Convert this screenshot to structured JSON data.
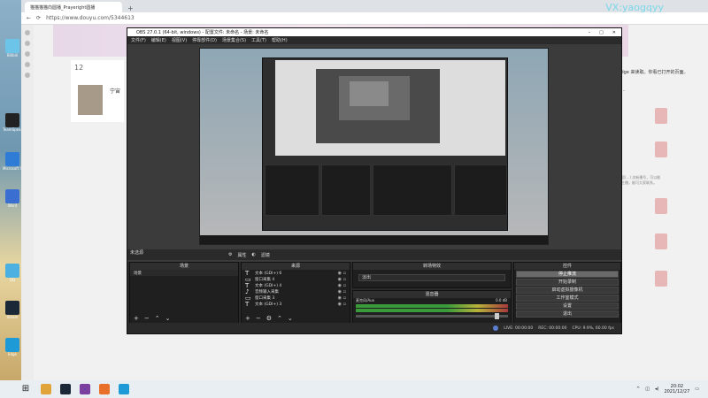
{
  "watermark": "VX:yaogqyy",
  "browser": {
    "tab_title": "猫猫猫猫向圆播_Prayeright圆播",
    "url": "https://www.douyu.com/5344613",
    "nav_back": "←",
    "nav_refresh": "⟳"
  },
  "douyu": {
    "count": "12",
    "streamer_name": "宁宙",
    "edge_notice": "oft Edge 来读取。你看已打开的页面。",
    "news_link": "长期活动...",
    "side_text": "文档内容(...) 次新播号，可以能力立以主播，能可大家联系。"
  },
  "obs": {
    "title": "OBS 27.0.1 (64-bit, windows) - 配置文件: 未命名 - 场景: 未命名",
    "menu": [
      "文件(F)",
      "编辑(E)",
      "视图(V)",
      "停靠部件(D)",
      "场景集合(S)",
      "工具(T)",
      "帮助(H)"
    ],
    "no_source": "未选源",
    "toolbar_properties": "属性",
    "toolbar_filters": "滤镜",
    "panels": {
      "scenes": "场景",
      "sources": "来源",
      "transitions": "转场特效",
      "mixer": "混音器",
      "controls": "控件"
    },
    "scene_items": [
      "场景"
    ],
    "sources": [
      {
        "icon": "T",
        "name": "文本 (GDI+) 6"
      },
      {
        "icon": "▭",
        "name": "窗口采集 4"
      },
      {
        "icon": "T",
        "name": "文本 (GDI+) 4"
      },
      {
        "icon": "♪",
        "name": "音频输入采集"
      },
      {
        "icon": "▭",
        "name": "窗口采集 3"
      },
      {
        "icon": "T",
        "name": "文本 (GDI+) 3"
      }
    ],
    "transition_value": "淡出",
    "mixer_label": "麦克风/Aux",
    "mixer_db": "0.0 dB",
    "controls": [
      "停止推流",
      "开始录制",
      "启动虚拟摄像机",
      "工作室模式",
      "设置",
      "退出"
    ],
    "status": {
      "live": "LIVE: 00:00:00",
      "rec": "REC: 00:00:00",
      "cpu": "CPU: 9.9%, 60.00 fps"
    }
  },
  "taskbar": {
    "time": "20:02",
    "date": "2021/12/27"
  },
  "desktop_icons": [
    "Bilibili",
    "TeamSpeak",
    "TeamSpe",
    "Microsoft Store",
    "Word",
    "QQ",
    "Steam",
    "OBS",
    "Edge"
  ]
}
